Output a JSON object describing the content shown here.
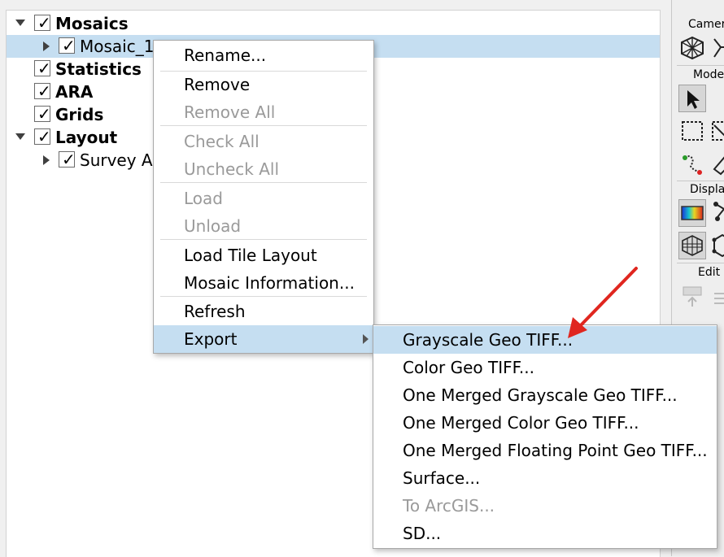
{
  "tree": {
    "items": [
      {
        "label": "Mosaics",
        "checked": true,
        "bold": true,
        "expander": "down",
        "level": 0
      },
      {
        "label": "Mosaic_1",
        "checked": true,
        "bold": false,
        "expander": "right",
        "level": 1,
        "selected": true
      },
      {
        "label": "Statistics",
        "checked": true,
        "bold": true,
        "expander": "",
        "level": 0
      },
      {
        "label": "ARA",
        "checked": true,
        "bold": true,
        "expander": "",
        "level": 0
      },
      {
        "label": "Grids",
        "checked": true,
        "bold": true,
        "expander": "",
        "level": 0
      },
      {
        "label": "Layout",
        "checked": true,
        "bold": true,
        "expander": "down",
        "level": 0
      },
      {
        "label": "Survey Are",
        "checked": true,
        "bold": false,
        "expander": "right",
        "level": 1
      }
    ]
  },
  "context_menu": {
    "items": [
      {
        "label": "Rename...",
        "enabled": true
      },
      {
        "label": "Remove",
        "enabled": true
      },
      {
        "label": "Remove All",
        "enabled": false
      },
      {
        "label": "Check All",
        "enabled": false
      },
      {
        "label": "Uncheck All",
        "enabled": false
      },
      {
        "label": "Load",
        "enabled": false
      },
      {
        "label": "Unload",
        "enabled": false
      },
      {
        "label": "Load Tile Layout",
        "enabled": true
      },
      {
        "label": "Mosaic Information...",
        "enabled": true
      },
      {
        "label": "Refresh",
        "enabled": true
      },
      {
        "label": "Export",
        "enabled": true,
        "highlighted": true,
        "has_submenu": true
      }
    ]
  },
  "export_submenu": {
    "items": [
      {
        "label": "Grayscale Geo TIFF...",
        "enabled": true,
        "highlighted": true
      },
      {
        "label": "Color Geo TIFF...",
        "enabled": true
      },
      {
        "label": "One Merged Grayscale Geo TIFF...",
        "enabled": true
      },
      {
        "label": "One Merged Color Geo TIFF...",
        "enabled": true
      },
      {
        "label": "One Merged Floating Point Geo TIFF...",
        "enabled": true
      },
      {
        "label": "Surface...",
        "enabled": true
      },
      {
        "label": "To ArcGIS...",
        "enabled": false
      },
      {
        "label": "SD...",
        "enabled": true
      }
    ]
  },
  "right_panel": {
    "sections": {
      "camera": "Camera",
      "mode": "Mode",
      "display": "Display",
      "edit": "Edit"
    }
  },
  "colors": {
    "selection": "#c5def1",
    "annotation_arrow": "#e0261f",
    "disabled_text": "#9a9a9a"
  }
}
